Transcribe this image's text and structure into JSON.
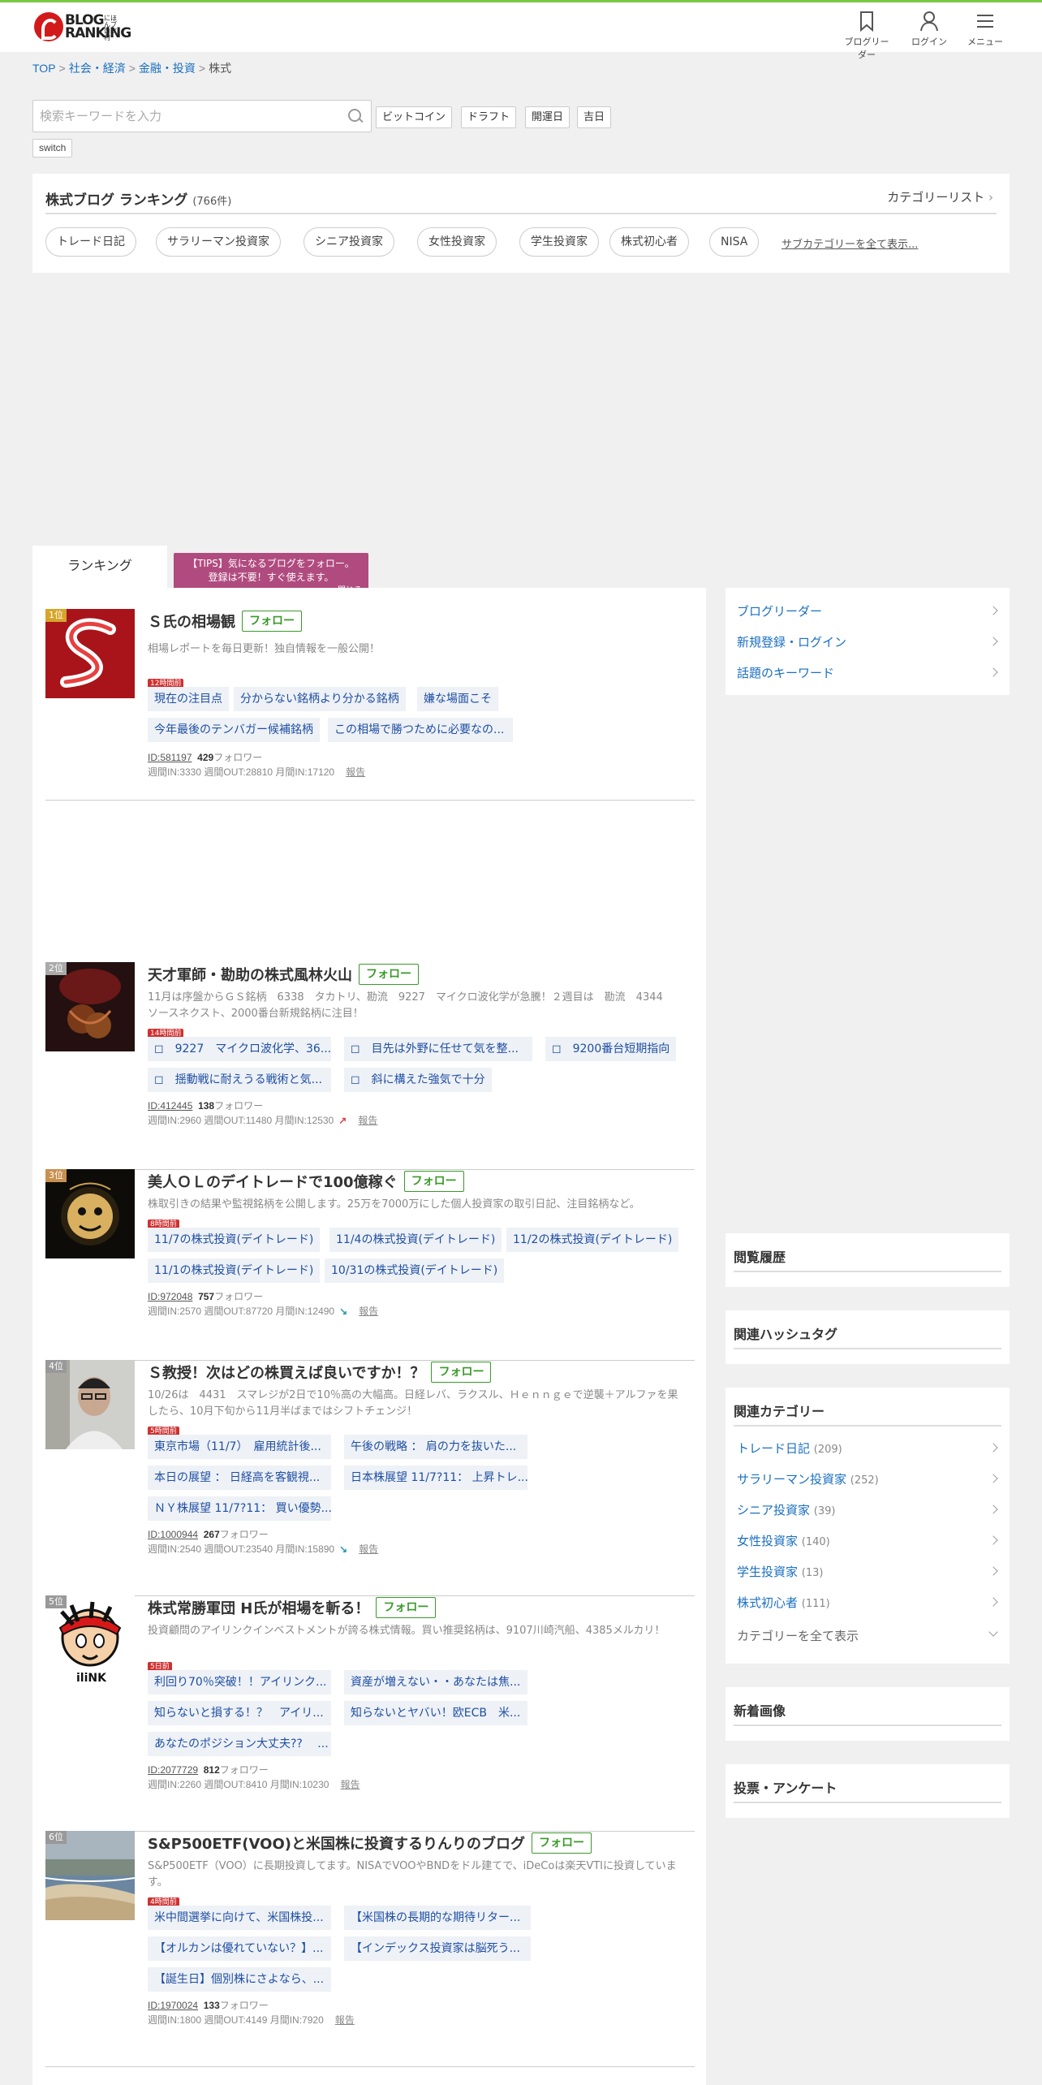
{
  "header": {
    "logo_line1": "BLOG",
    "logo_line2": "RANKING",
    "logo_small": "にほんブログ村",
    "reader_label": "ブログリーダー",
    "login_label": "ログイン",
    "menu_label": "メニュー"
  },
  "breadcrumb": {
    "items": [
      "TOP",
      "社会・経済",
      "金融・投資"
    ],
    "current": "株式",
    "sep": ">"
  },
  "search": {
    "placeholder": "検索キーワードを入力",
    "keywords": [
      "ビットコイン",
      "ドラフト",
      "開運日",
      "吉日"
    ],
    "switch_label": "switch"
  },
  "ranking_header": {
    "title": "株式ブログ ランキング",
    "count": "(766件)",
    "category_list_link": "カテゴリーリスト",
    "subcategories": [
      "トレード日記",
      "サラリーマン投資家",
      "シニア投資家",
      "女性投資家",
      "学生投資家",
      "株式初心者",
      "NISA"
    ],
    "show_all_sub": "サブカテゴリーを全て表示..."
  },
  "tabs": {
    "ranking": "ランキング"
  },
  "tips": {
    "line1": "【TIPS】気になるブログをフォロー。",
    "line2": "登録は不要！すぐ使えます。",
    "close": "閉じる"
  },
  "entries": [
    {
      "rank": "1位",
      "title": "Ｓ氏の相場観",
      "follow": "フォロー",
      "desc": "相場レポートを毎日更新！独自情報を一般公開！",
      "hours": "12時間前",
      "chips": [
        "現在の注目点",
        "分からない銘柄より分かる銘柄",
        "嫌な場面こそ",
        "今年最後のテンバガー候補銘柄",
        "この相場で勝つために必要なの..."
      ],
      "id": "ID:581197",
      "followers": "429",
      "followers_label": "フォロワー",
      "stats": "週間IN:3330  週間OUT:28810  月間IN:17120",
      "report": "報告"
    },
    {
      "rank": "2位",
      "title": "天才軍師・勘助の株式風林火山",
      "follow": "フォロー",
      "desc": "11月は序盤からＧＳ銘柄　6338　タカトリ、勘流　9227　マイクロ波化学が急騰！２週目は　勘流　4344　ソースネクスト、2000番台新規銘柄に注目！",
      "hours": "14時間前",
      "chips": [
        "◻　9227　マイクロ波化学、36...",
        "◻　目先は外野に任せて気を整...",
        "◻　9200番台短期指向",
        "◻　揺動戦に耐えうる戦術と気...",
        "◻　斜に構えた強気で十分"
      ],
      "id": "ID:412445",
      "followers": "138",
      "followers_label": "フォロワー",
      "stats": "週間IN:2960  週間OUT:11480  月間IN:12530",
      "trend": "↗",
      "report": "報告"
    },
    {
      "rank": "3位",
      "title": "美人ＯＬのデイトレードで100億稼ぐ",
      "follow": "フォロー",
      "desc": "株取引きの結果や監視銘柄を公開します。25万を7000万にした個人投資家の取引日記、注目銘柄など。",
      "hours": "8時間前",
      "chips": [
        "11/7の株式投資(デイトレード)",
        "11/4の株式投資(デイトレード)",
        "11/2の株式投資(デイトレード)",
        "11/1の株式投資(デイトレード)",
        "10/31の株式投資(デイトレード)"
      ],
      "id": "ID:972048",
      "followers": "757",
      "followers_label": "フォロワー",
      "stats": "週間IN:2570  週間OUT:87720  月間IN:12490",
      "trend": "↘",
      "report": "報告"
    },
    {
      "rank": "4位",
      "title": "Ｓ教授！次はどの株買えば良いですか！？",
      "follow": "フォロー",
      "desc": "10/26は　4431　スマレジが2日で10％高の大幅高。日経レバ、ラクスル、Ｈｅｎｎｇｅで逆襲＋アルファを果したら、10月下旬から11月半ばまではシフトチェンジ！",
      "hours": "5時間前",
      "chips": [
        "東京市場（11/7）　雇用統計後...",
        "午後の戦略 ： 肩の力を抜いた...",
        "本日の展望 ： 日経高を客観視...",
        "日本株展望 11/7?11： 上昇トレ...",
        "ＮＹ株展望 11/7?11： 買い優勢..."
      ],
      "id": "ID:1000944",
      "followers": "267",
      "followers_label": "フォロワー",
      "stats": "週間IN:2540  週間OUT:23540  月間IN:15890",
      "trend": "↘",
      "report": "報告"
    },
    {
      "rank": "5位",
      "title": "株式常勝軍団 H氏が相場を斬る！",
      "follow": "フォロー",
      "desc": "投資顧問のアイリンクインベストメントが誇る株式情報。買い推奨銘柄は、9107川崎汽船、4385メルカリ！",
      "hours": "5日前",
      "chips": [
        "利回り70％突破！！アイリンク...",
        "資産が増えない・・あなたは焦...",
        "知らないと損する！？　アイリ...",
        "知らないとヤバい！欧ECB　米...",
        "あなたのポジション大丈夫?? 　..."
      ],
      "id": "ID:2077729",
      "followers": "812",
      "followers_label": "フォロワー",
      "stats": "週間IN:2260  週間OUT:8410  月間IN:10230",
      "report": "報告"
    },
    {
      "rank": "6位",
      "title": "S&P500ETF(VOO)と米国株に投資するりんりのブログ",
      "follow": "フォロー",
      "desc": "S&P500ETF（VOO）に長期投資してます。NISAでVOOやBNDをドル建てで、iDeCoは楽天VTIに投資しています。",
      "hours": "4時間前",
      "chips": [
        "米中間選挙に向けて、米国株投...",
        "【米国株の長期的な期待リター...",
        "【オルカンは優れていない？】...",
        "【インデックス投資家は脳死う...",
        "【誕生日】個別株にさよなら、..."
      ],
      "id": "ID:1970024",
      "followers": "133",
      "followers_label": "フォロワー",
      "stats": "週間IN:1800  週間OUT:4149  月間IN:7920",
      "report": "報告"
    }
  ],
  "sidebar": {
    "links": [
      "ブログリーダー",
      "新規登録・ログイン",
      "話題のキーワード"
    ],
    "history_title": "閲覧履歴",
    "hashtag_title": "関連ハッシュタグ",
    "related_title": "関連カテゴリー",
    "related": [
      {
        "name": "トレード日記",
        "count": "(209)"
      },
      {
        "name": "サラリーマン投資家",
        "count": "(252)"
      },
      {
        "name": "シニア投資家",
        "count": "(39)"
      },
      {
        "name": "女性投資家",
        "count": "(140)"
      },
      {
        "name": "学生投資家",
        "count": "(13)"
      },
      {
        "name": "株式初心者",
        "count": "(111)"
      }
    ],
    "show_all_categories": "カテゴリーを全て表示",
    "new_images_title": "新着画像",
    "poll_title": "投票・アンケート"
  },
  "colors": {
    "accent_green": "#7ac943",
    "link_blue": "#1a6fc0",
    "tips_bg": "#b04b7f",
    "follow_green": "#3a9a2a"
  }
}
